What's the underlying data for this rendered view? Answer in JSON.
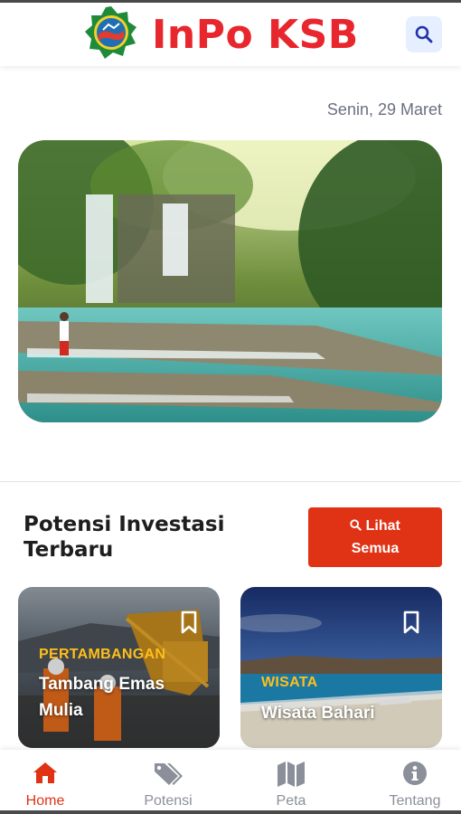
{
  "header": {
    "title": "InPo KSB",
    "logo": "ksb-emblem-logo",
    "search_icon": "search-icon"
  },
  "date_text": "Senin, 29 Maret",
  "hero": {
    "image": "waterfall-photo"
  },
  "section": {
    "title": "Potensi Investasi Terbaru",
    "see_all_line1": "Lihat",
    "see_all_line2": "Semua",
    "see_all_icon": "search-icon"
  },
  "cards": [
    {
      "category": "PERTAMBANGAN",
      "title": "Tambang Emas Mulia",
      "image": "mining-photo",
      "bookmark_icon": "bookmark-icon"
    },
    {
      "category": "WISATA",
      "title": "Wisata Bahari",
      "image": "beach-photo",
      "bookmark_icon": "bookmark-icon"
    }
  ],
  "bottom_nav": {
    "items": [
      {
        "label": "Home",
        "icon": "home-icon",
        "active": true
      },
      {
        "label": "Potensi",
        "icon": "tags-icon",
        "active": false
      },
      {
        "label": "Peta",
        "icon": "map-icon",
        "active": false
      },
      {
        "label": "Tentang",
        "icon": "info-icon",
        "active": false
      }
    ]
  },
  "colors": {
    "brand_red": "#e8262d",
    "button_red": "#e03214",
    "category_yellow": "#ffbf1a",
    "nav_inactive": "#8a8f99",
    "search_bg": "#e5efff",
    "search_icon": "#2233aa"
  }
}
